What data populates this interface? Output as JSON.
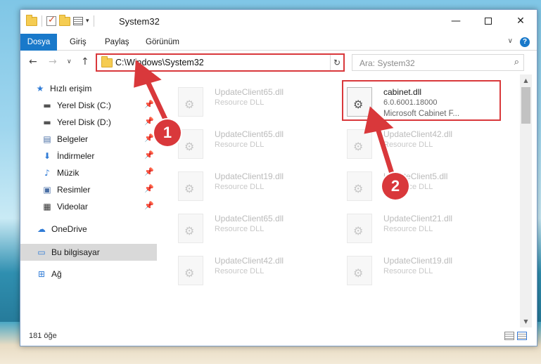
{
  "window": {
    "title": "System32",
    "minimize_glyph": "—",
    "close_glyph": "✕"
  },
  "ribbon": {
    "tabs": [
      "Dosya",
      "Giriş",
      "Paylaş",
      "Görünüm"
    ],
    "help_glyph": "?",
    "expand_glyph": "∨"
  },
  "nav": {
    "back_glyph": "←",
    "forward_glyph": "→",
    "recent_glyph": "∨",
    "up_glyph": "↑",
    "address": "C:\\Windows\\System32",
    "address_dropdown_glyph": "∨",
    "refresh_glyph": "↻",
    "search_placeholder": "Ara: System32",
    "search_glyph": "⌕"
  },
  "sidebar": {
    "items": [
      {
        "label": "Hızlı erişim",
        "icon": "star-icon",
        "glyph": "★",
        "pinned": false
      },
      {
        "label": "Yerel Disk (C:)",
        "icon": "drive-icon",
        "glyph": "▬",
        "pinned": true
      },
      {
        "label": "Yerel Disk (D:)",
        "icon": "drive-icon",
        "glyph": "▬",
        "pinned": true
      },
      {
        "label": "Belgeler",
        "icon": "documents-icon",
        "glyph": "▤",
        "pinned": true
      },
      {
        "label": "İndirmeler",
        "icon": "download-icon",
        "glyph": "⬇",
        "pinned": true
      },
      {
        "label": "Müzik",
        "icon": "music-icon",
        "glyph": "♪",
        "pinned": true
      },
      {
        "label": "Resimler",
        "icon": "pictures-icon",
        "glyph": "▣",
        "pinned": true
      },
      {
        "label": "Videolar",
        "icon": "video-icon",
        "glyph": "▦",
        "pinned": true
      },
      {
        "label": "OneDrive",
        "icon": "cloud-icon",
        "glyph": "☁",
        "pinned": false
      },
      {
        "label": "Bu bilgisayar",
        "icon": "computer-icon",
        "glyph": "▭",
        "pinned": false
      },
      {
        "label": "Ağ",
        "icon": "network-icon",
        "glyph": "⊞",
        "pinned": false
      }
    ],
    "pin_glyph": "📌"
  },
  "files": {
    "highlighted": {
      "name": "cabinet.dll",
      "version": "6.0.6001.18000",
      "description": "Microsoft Cabinet F..."
    },
    "faded": [
      {
        "name": "UpdateClient65.dll",
        "type": "Resource DLL"
      },
      {
        "name": "UpdateClient65.dll",
        "type": "Resource DLL"
      },
      {
        "name": "UpdateClient42.dll",
        "type": "Resource DLL"
      },
      {
        "name": "UpdateClient19.dll",
        "type": "Resource DLL"
      },
      {
        "name": "UpdateClient5.dll",
        "type": "Resource DLL"
      },
      {
        "name": "UpdateClient65.dll",
        "type": "Resource DLL"
      },
      {
        "name": "UpdateClient21.dll",
        "type": "Resource DLL"
      },
      {
        "name": "UpdateClient42.dll",
        "type": "Resource DLL"
      },
      {
        "name": "UpdateClient19.dll",
        "type": "Resource DLL"
      }
    ]
  },
  "status": {
    "item_count": "181 öğe"
  },
  "callouts": [
    "1",
    "2"
  ],
  "colors": {
    "accent": "#1979ca",
    "highlight": "#d9383b"
  }
}
